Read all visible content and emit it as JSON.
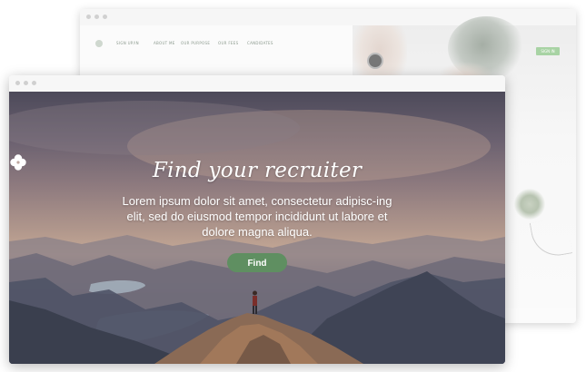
{
  "back_window": {
    "nav_items": [
      "SIGN UP/IN",
      "ABOUT ME",
      "OUR PURPOSE",
      "OUR FEES",
      "CANDIDATES"
    ],
    "button_label": "SIGN IN"
  },
  "front_window": {
    "hero": {
      "icon": "clover-icon",
      "title": "Find your recruiter",
      "body": "Lorem ipsum dolor sit amet, consectetur adipisc-ing elit, sed do eiusmod tempor incididunt ut labore et dolore magna aliqua.",
      "button_label": "Find"
    }
  },
  "colors": {
    "accent": "#5f8f61",
    "accent_light": "#a8d3a4"
  }
}
